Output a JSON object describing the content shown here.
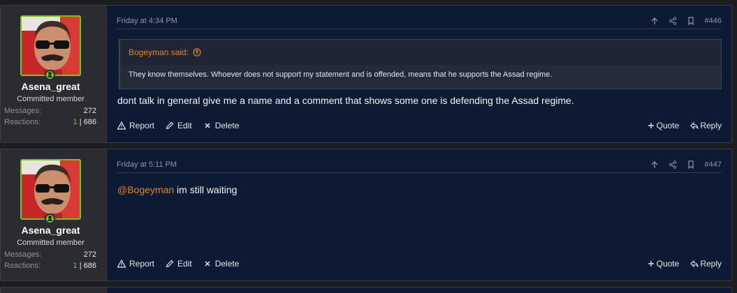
{
  "posts": [
    {
      "user": {
        "name": "Asena_great",
        "title": "Committed member",
        "messages_label": "Messages:",
        "messages": "272",
        "reactions_label": "Reactions:",
        "reactions_pos": "1",
        "reactions_sep": "|",
        "reactions_total": "686"
      },
      "date": "Friday at 4:34 PM",
      "number": "#446",
      "quote": {
        "author": "Bogeyman said:",
        "text": "They know themselves. Whoever does not support my statement and is offended, means that he supports the Assad regime."
      },
      "text": "dont talk in general give me a name and a comment that shows some one is defending the Assad regime.",
      "actions": {
        "report": "Report",
        "edit": "Edit",
        "delete": "Delete",
        "quote": "Quote",
        "reply": "Reply"
      }
    },
    {
      "user": {
        "name": "Asena_great",
        "title": "Committed member",
        "messages_label": "Messages:",
        "messages": "272",
        "reactions_label": "Reactions:",
        "reactions_pos": "1",
        "reactions_sep": "|",
        "reactions_total": "686"
      },
      "date": "Friday at 5:11 PM",
      "number": "#447",
      "mention": "@Bogeyman",
      "text": " im still waiting",
      "actions": {
        "report": "Report",
        "edit": "Edit",
        "delete": "Delete",
        "quote": "Quote",
        "reply": "Reply"
      }
    }
  ],
  "colors": {
    "accent": "#e8821e",
    "online": "#7cc21a",
    "post_bg": "#0d1a33",
    "user_bg": "#2a2c31"
  },
  "icons": [
    "arrow-up-icon",
    "share-icon",
    "bookmark-icon",
    "warning-icon",
    "pencil-icon",
    "close-icon",
    "plus-icon",
    "reply-icon",
    "arrow-circle-up-icon",
    "online-status-icon"
  ]
}
